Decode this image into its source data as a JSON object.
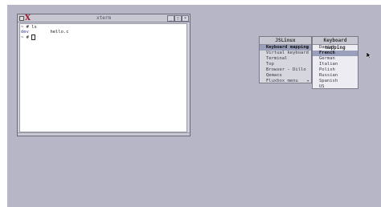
{
  "xterm": {
    "title": "xterm",
    "lines": [
      {
        "prompt": "~ # ",
        "text": "ls"
      },
      {
        "dir": "dev",
        "file": "hello.c"
      },
      {
        "prompt": "~ # ",
        "text": ""
      }
    ],
    "buttons": {
      "minimize": "_",
      "maximize": "□",
      "close": "×"
    }
  },
  "root_menu": {
    "title": "JSLinux",
    "items": [
      {
        "label": "Keyboard mapping",
        "highlighted": true,
        "submenu": true
      },
      {
        "label": "Virtual keyboard"
      },
      {
        "label": "Terminal"
      },
      {
        "label": "Top"
      },
      {
        "label": "Browser - Dillo"
      },
      {
        "label": "Qemacs"
      },
      {
        "label": "Fluxbox menu",
        "submenu": true
      }
    ]
  },
  "keyboard_submenu": {
    "title": "Keyboard mapping",
    "items": [
      {
        "label": "Danish"
      },
      {
        "label": "French",
        "highlighted": true
      },
      {
        "label": "German"
      },
      {
        "label": "Italian"
      },
      {
        "label": "Polish"
      },
      {
        "label": "Russian"
      },
      {
        "label": "Spanish"
      },
      {
        "label": "US"
      }
    ]
  },
  "icons": {
    "submenu_arrow": "▸",
    "xterm_logo": "x-logo-icon"
  }
}
